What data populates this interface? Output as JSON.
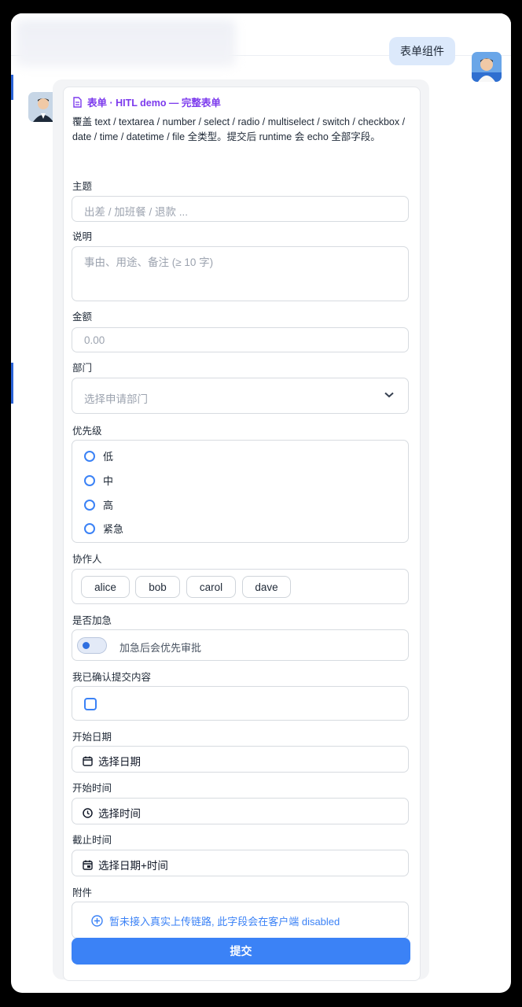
{
  "chat": {
    "user_message": "表单组件"
  },
  "form": {
    "title": "表单 · HITL demo — 完整表单",
    "description": "覆盖 text / textarea / number / select / radio / multiselect / switch / checkbox / date / time / datetime / file 全类型。提交后 runtime 会 echo 全部字段。",
    "subject": {
      "label": "主题",
      "placeholder": "出差 / 加班餐 / 退款 ..."
    },
    "explanation": {
      "label": "说明",
      "placeholder": "事由、用途、备注 (≥ 10 字)"
    },
    "amount": {
      "label": "金额",
      "placeholder": "0.00"
    },
    "department": {
      "label": "部门",
      "placeholder": "选择申请部门"
    },
    "priority": {
      "label": "优先级",
      "options": [
        "低",
        "中",
        "高",
        "紧急"
      ]
    },
    "collaborators": {
      "label": "协作人",
      "options": [
        "alice",
        "bob",
        "carol",
        "dave"
      ]
    },
    "urgent": {
      "label": "是否加急",
      "hint": "加急后会优先审批"
    },
    "confirm": {
      "label": "我已确认提交内容"
    },
    "start_date": {
      "label": "开始日期",
      "button": "选择日期"
    },
    "start_time": {
      "label": "开始时间",
      "button": "选择时间"
    },
    "deadline": {
      "label": "截止时间",
      "button": "选择日期+时间"
    },
    "attachment": {
      "label": "附件",
      "text": "暂未接入真实上传链路, 此字段会在客户端 disabled"
    },
    "submit_label": "提交"
  },
  "colors": {
    "accent": "#3b82f6",
    "title_purple": "#7c3aed",
    "user_bubble": "#dce9fb"
  }
}
